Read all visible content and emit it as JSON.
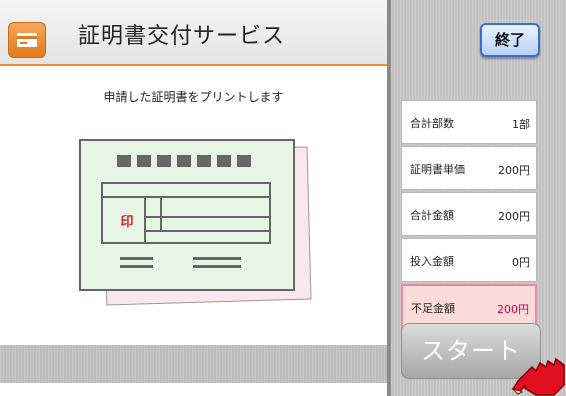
{
  "header": {
    "title": "証明書交付サービス",
    "icon": "card-icon"
  },
  "main": {
    "instruction": "申請した証明書をプリントします",
    "seal_text": "印"
  },
  "side": {
    "end_label": "終了",
    "rows": [
      {
        "label": "合計部数",
        "value": "1部"
      },
      {
        "label": "証明書単価",
        "value": "200円"
      },
      {
        "label": "合計金額",
        "value": "200円"
      },
      {
        "label": "投入金額",
        "value": "0円"
      },
      {
        "label": "不足金額",
        "value": "200円",
        "alert": true
      }
    ],
    "start_label": "スタート"
  },
  "colors": {
    "accent": "#f08a2a",
    "alert": "#d8004b",
    "end_border": "#3a6fd1"
  }
}
